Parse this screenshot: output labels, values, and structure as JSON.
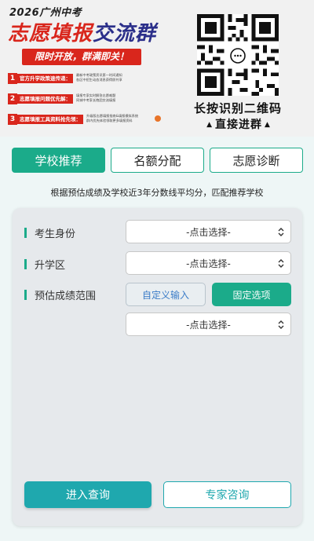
{
  "banner": {
    "year_title": "2026广州中考",
    "title_part1": "志愿填报",
    "title_part2": "交流群",
    "subtitle": "限时开放，群满即关！",
    "items": [
      {
        "num": "1",
        "title": "官方升学政策速传递：",
        "lines": [
          "最新中考政策资讯第一时间通知",
          "各区中招生动态消息获得即共享"
        ]
      },
      {
        "num": "2",
        "title": "志愿填报问题优先解：",
        "lines": [
          "填报专家实时解答志愿难题",
          "同城中考家长抱团交流填报"
        ]
      },
      {
        "num": "3",
        "title": "志愿填报工具资料抢先领：",
        "lines": [
          "升级版志愿填报指南&填报模拟系统",
          "群内优先体验领取更多填报资料"
        ]
      }
    ],
    "qr_caption_line1": "长按识别二维码",
    "qr_caption_line2": "直接进群",
    "colors": {
      "red": "#d9261c",
      "navy": "#2b2f8a"
    }
  },
  "tabs": [
    {
      "label": "学校推荐",
      "active": true
    },
    {
      "label": "名额分配",
      "active": false
    },
    {
      "label": "志愿诊断",
      "active": false
    }
  ],
  "description": "根据预估成绩及学校近3年分数线平均分，匹配推荐学校",
  "form": {
    "identity": {
      "label": "考生身份",
      "value": "-点击选择-"
    },
    "district": {
      "label": "升学区",
      "value": "-点击选择-"
    },
    "score_range": {
      "label": "预估成绩范围",
      "custom_button": "自定义输入",
      "fixed_button": "固定选项",
      "value": "-点击选择-"
    }
  },
  "actions": {
    "query": "进入查询",
    "expert": "专家咨询"
  },
  "colors": {
    "accent": "#1bab8a",
    "button": "#1fa8ae",
    "link": "#3b7cc8"
  }
}
